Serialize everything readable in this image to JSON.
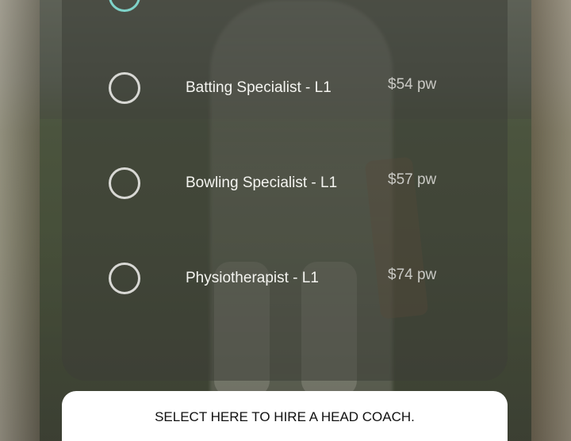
{
  "options": [
    {
      "label": "",
      "price": "",
      "selected": true
    },
    {
      "label": "Batting Specialist - L1",
      "price": "$54 pw",
      "selected": false
    },
    {
      "label": "Bowling Specialist - L1",
      "price": "$57 pw",
      "selected": false
    },
    {
      "label": "Physiotherapist - L1",
      "price": "$74 pw",
      "selected": false
    }
  ],
  "cta": {
    "label": "SELECT HERE TO HIRE A HEAD COACH."
  },
  "colors": {
    "accent": "#7fd3c9",
    "radio_border": "#d8d8d4",
    "panel": "#3c3e37",
    "button_bg": "#ffffff"
  },
  "icons": {
    "radio_selected": "radio-selected-icon",
    "radio_unselected": "radio-unselected-icon"
  }
}
